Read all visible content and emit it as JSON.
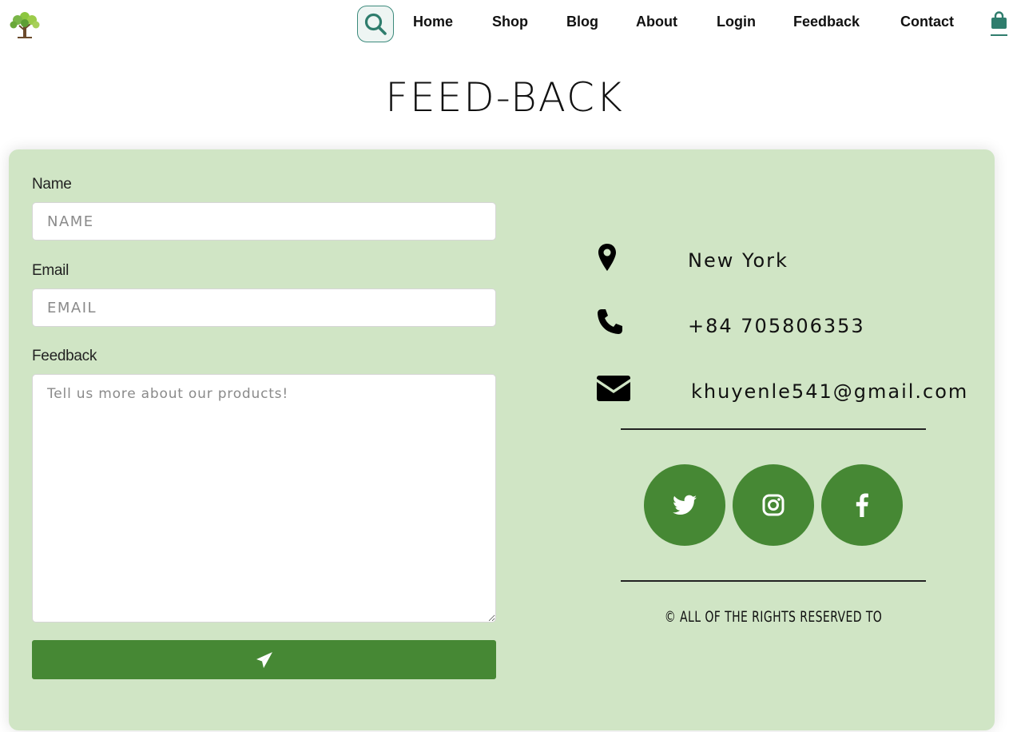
{
  "header": {
    "logo_icon": "tree-logo-icon",
    "search_icon": "search-icon",
    "nav": [
      {
        "label": "Home"
      },
      {
        "label": "Shop"
      },
      {
        "label": "Blog"
      },
      {
        "label": "About"
      },
      {
        "label": "Login"
      },
      {
        "label": "Feedback"
      },
      {
        "label": "Contact"
      }
    ],
    "cart_icon": "shopping-bag-icon"
  },
  "page": {
    "title": "FEED-BACK"
  },
  "form": {
    "name_label": "Name",
    "name_placeholder": "NAME",
    "email_label": "Email",
    "email_placeholder": "EMAIL",
    "feedback_label": "Feedback",
    "feedback_placeholder": "Tell us more about our products!",
    "submit_icon": "paper-plane-icon"
  },
  "contact": {
    "location": "New York",
    "phone": "+84 705806353",
    "email": "khuyenle541@gmail.com",
    "socials": [
      {
        "icon": "twitter-icon"
      },
      {
        "icon": "instagram-icon"
      },
      {
        "icon": "facebook-icon"
      }
    ],
    "copyright": "© ALL OF THE RIGHTS RESERVED TO"
  },
  "colors": {
    "card_bg": "#d0e5c5",
    "accent_green": "#468834",
    "teal": "#2f7d6d"
  }
}
